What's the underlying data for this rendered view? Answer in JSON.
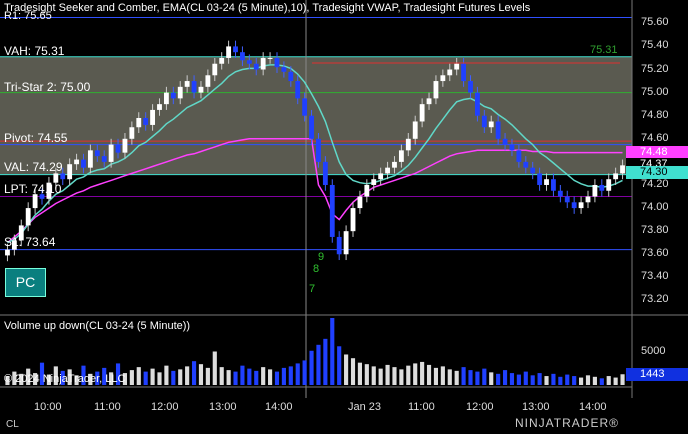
{
  "header": {
    "title": "Tradesight Seeker and Comber, EMA(CL 03-24 (5 Minute),10), Tradesight VWAP, Tradesight Futures Levels",
    "r1_label": "R1: 75.65"
  },
  "levels": [
    {
      "name": "VAH",
      "label": "VAH: 75.31",
      "value": 75.31,
      "color": "#40e0d0"
    },
    {
      "name": "Tri-Star 2",
      "label": "Tri-Star 2: 75.00",
      "value": 75.0,
      "color": "#30b030"
    },
    {
      "name": "Pivot",
      "label": "Pivot: 74.55",
      "value": 74.55,
      "color": "#3050ff"
    },
    {
      "name": "VAL",
      "label": "VAL: 74.29",
      "value": 74.29,
      "color": "#40e0d0"
    },
    {
      "name": "LPT",
      "label": "LPT: 74.10",
      "value": 74.1,
      "color": "#8000a0"
    },
    {
      "name": "S1",
      "label": "S1: 73.64",
      "value": 73.64,
      "color": "#3050ff"
    }
  ],
  "price_axis": {
    "min": 73.1,
    "max": 75.75,
    "ticks": [
      "75.60",
      "75.40",
      "75.20",
      "75.00",
      "74.80",
      "74.60",
      "74.40",
      "74.20",
      "74.00",
      "73.80",
      "73.60",
      "73.40",
      "73.20"
    ],
    "tags": [
      {
        "label": "74.48",
        "value": 74.48,
        "bg": "#ff40ff",
        "fg": "#fff"
      },
      {
        "label": "74.37",
        "value": 74.37,
        "bg": "#000",
        "fg": "#fff"
      },
      {
        "label": "74.30",
        "value": 74.3,
        "bg": "#40e0d0",
        "fg": "#000"
      }
    ]
  },
  "time_axis": {
    "labels": [
      "10:00",
      "11:00",
      "12:00",
      "13:00",
      "14:00",
      "Jan 23",
      "11:00",
      "12:00",
      "13:00",
      "14:00"
    ]
  },
  "annotations": {
    "target_label": "75.31",
    "seq_labels": [
      "9",
      "8",
      "7"
    ]
  },
  "indicator_button": {
    "label": "PC"
  },
  "volume_panel": {
    "title": "Volume up down(CL 03-24 (5 Minute))",
    "tick": "5000",
    "last_tag": "1443",
    "max": 9000
  },
  "footer": {
    "copyright": "© 2024 NinjaTrader, LLC",
    "instrument": "CL",
    "logo": "NINJATRADER®"
  },
  "chart_data": {
    "type": "candlestick",
    "title": "Tradesight Seeker and Comber, EMA(CL 03-24 (5 Minute),10), Tradesight VWAP, Tradesight Futures Levels",
    "closes": [
      73.64,
      73.72,
      73.85,
      74.0,
      74.12,
      74.08,
      74.22,
      74.3,
      74.25,
      74.38,
      74.42,
      74.35,
      74.5,
      74.45,
      74.4,
      74.55,
      74.48,
      74.6,
      74.7,
      74.78,
      74.72,
      74.85,
      74.9,
      75.0,
      74.95,
      75.05,
      75.1,
      75.0,
      75.05,
      75.15,
      75.25,
      75.3,
      75.4,
      75.35,
      75.28,
      75.25,
      75.2,
      75.3,
      75.3,
      75.22,
      75.18,
      75.1,
      74.95,
      74.8,
      74.6,
      74.4,
      74.2,
      73.75,
      73.6,
      73.8,
      74.0,
      74.1,
      74.2,
      74.25,
      74.3,
      74.35,
      74.4,
      74.5,
      74.6,
      74.75,
      74.9,
      74.95,
      75.1,
      75.15,
      75.2,
      75.25,
      75.1,
      75.0,
      74.8,
      74.7,
      74.75,
      74.6,
      74.55,
      74.5,
      74.4,
      74.35,
      74.3,
      74.2,
      74.25,
      74.15,
      74.1,
      74.05,
      74.0,
      74.05,
      74.1,
      74.2,
      74.15,
      74.25,
      74.3,
      74.37
    ],
    "volume": [
      1200,
      1800,
      1500,
      2200,
      1600,
      3000,
      1400,
      2500,
      1900,
      2100,
      1300,
      2600,
      1500,
      1800,
      2300,
      1700,
      2900,
      1600,
      2000,
      2400,
      1800,
      2200,
      1700,
      2600,
      1900,
      2100,
      2500,
      3200,
      2800,
      2300,
      4500,
      2400,
      2000,
      1800,
      2600,
      2200,
      1900,
      2400,
      2100,
      1800,
      2300,
      2500,
      2900,
      3300,
      4600,
      5400,
      6200,
      9000,
      5200,
      4100,
      3600,
      3000,
      2800,
      2500,
      2200,
      2700,
      2400,
      2100,
      2600,
      2900,
      3100,
      2700,
      2300,
      2500,
      2100,
      1900,
      2400,
      2000,
      1800,
      2200,
      1700,
      1500,
      2000,
      1600,
      1400,
      1800,
      1300,
      1600,
      1200,
      1500,
      1100,
      1400,
      1200,
      1000,
      1300,
      1100,
      900,
      1200,
      1000,
      1443
    ],
    "ema": [
      73.7,
      73.73,
      73.78,
      73.86,
      73.94,
      73.99,
      74.06,
      74.12,
      74.15,
      74.2,
      74.25,
      74.27,
      74.31,
      74.33,
      74.34,
      74.38,
      74.4,
      74.43,
      74.48,
      74.54,
      74.57,
      74.62,
      74.67,
      74.73,
      74.77,
      74.82,
      74.87,
      74.9,
      74.93,
      74.98,
      75.03,
      75.08,
      75.14,
      75.18,
      75.2,
      75.21,
      75.21,
      75.23,
      75.24,
      75.24,
      75.23,
      75.21,
      75.16,
      75.09,
      74.99,
      74.88,
      74.75,
      74.57,
      74.4,
      74.29,
      74.24,
      74.22,
      74.21,
      74.22,
      74.24,
      74.26,
      74.28,
      74.32,
      74.37,
      74.44,
      74.52,
      74.6,
      74.69,
      74.77,
      74.85,
      74.92,
      74.94,
      74.95,
      74.92,
      74.88,
      74.86,
      74.81,
      74.77,
      74.72,
      74.66,
      74.6,
      74.55,
      74.48,
      74.44,
      74.39,
      74.34,
      74.29,
      74.24,
      74.21,
      74.19,
      74.19,
      74.18,
      74.19,
      74.21,
      74.24
    ],
    "vwap": [
      73.7,
      73.75,
      73.8,
      73.86,
      73.92,
      73.96,
      74.0,
      74.04,
      74.07,
      74.1,
      74.13,
      74.15,
      74.18,
      74.2,
      74.22,
      74.24,
      74.26,
      74.28,
      74.3,
      74.32,
      74.34,
      74.36,
      74.38,
      74.4,
      74.42,
      74.44,
      74.46,
      74.47,
      74.49,
      74.51,
      74.53,
      74.55,
      74.57,
      74.58,
      74.59,
      74.6,
      74.6,
      74.6,
      74.6,
      74.6,
      74.6,
      74.6,
      74.6,
      74.6,
      74.6,
      74.2,
      74.1,
      73.95,
      73.9,
      73.98,
      74.05,
      74.1,
      74.14,
      74.18,
      74.2,
      74.22,
      74.24,
      74.26,
      74.28,
      74.3,
      74.33,
      74.36,
      74.39,
      74.42,
      74.45,
      74.47,
      74.48,
      74.49,
      74.5,
      74.5,
      74.5,
      74.5,
      74.5,
      74.5,
      74.5,
      74.5,
      74.49,
      74.49,
      74.49,
      74.48,
      74.48,
      74.48,
      74.48,
      74.48,
      74.48,
      74.48,
      74.48,
      74.48,
      74.48,
      74.48
    ],
    "ylim": [
      73.1,
      75.75
    ]
  }
}
